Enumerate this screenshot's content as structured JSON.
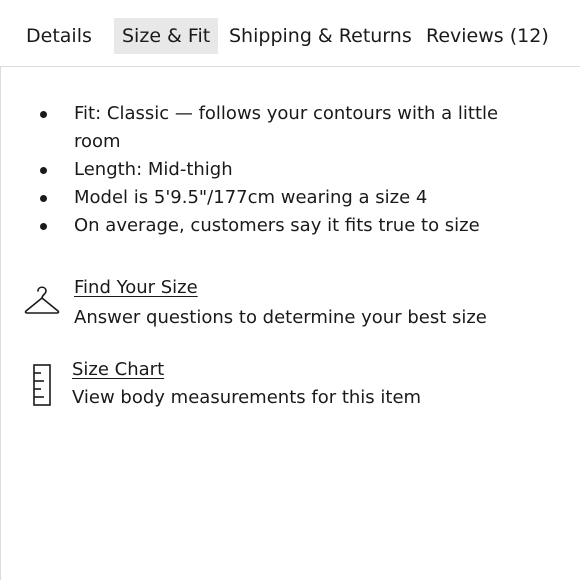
{
  "tabs": [
    {
      "label": "Details",
      "active": false
    },
    {
      "label": "Size & Fit",
      "active": true
    },
    {
      "label": "Shipping & Returns",
      "active": false
    },
    {
      "label": "Reviews (12)",
      "active": false
    }
  ],
  "fit_bullets": [
    "Fit: Classic — follows your contours with a little room",
    "Length: Mid-thigh",
    "Model is 5'9.5\"/177cm wearing a size 4",
    "On average, customers say it fits true to size"
  ],
  "find_size": {
    "icon": "hanger-icon",
    "link": "Find Your Size",
    "description": "Answer questions to determine your best size"
  },
  "size_chart": {
    "icon": "ruler-icon",
    "link": "Size Chart",
    "description": "View body measurements for this item"
  },
  "colors": {
    "active_tab_bg": "#e8e8e8",
    "text": "#1a1a1a",
    "divider": "#dcdcdc"
  }
}
